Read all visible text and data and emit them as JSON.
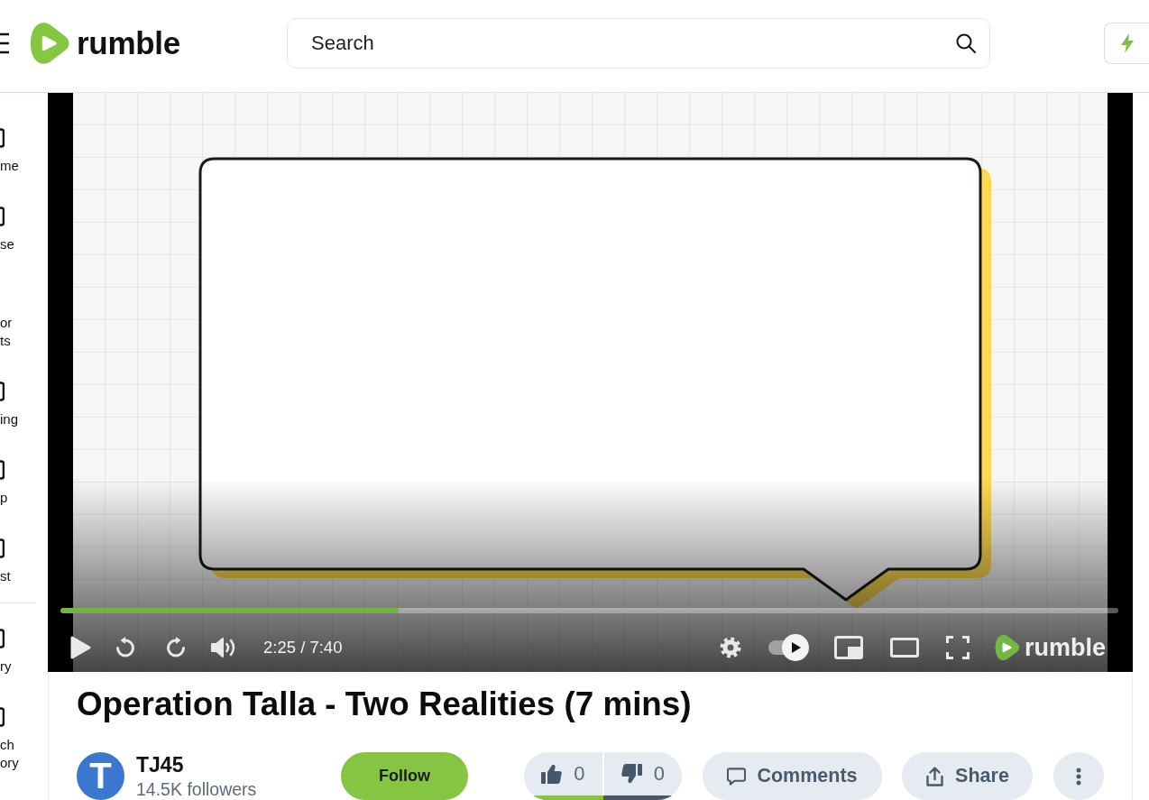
{
  "header": {
    "logo_text": "rumble",
    "search": {
      "placeholder": "Search"
    }
  },
  "sidebar": {
    "sections": [
      {
        "items": [
          {
            "label": "me",
            "has_icon": true
          },
          {
            "label": "se",
            "has_icon": true
          },
          {
            "label": "or ts",
            "has_icon": false
          },
          {
            "label": "ing",
            "has_icon": true
          },
          {
            "label": "p",
            "has_icon": true
          },
          {
            "label": "st",
            "has_icon": true
          }
        ]
      },
      {
        "items": [
          {
            "label": "ry",
            "has_icon": true
          },
          {
            "label": "ch ory",
            "has_icon": true
          }
        ]
      }
    ]
  },
  "player": {
    "progress": {
      "level": 0.32
    },
    "playing": false,
    "time": "2:25 / 7:40",
    "autoplay": {
      "on": true
    },
    "logo_text": "rumble"
  },
  "video": {
    "title": "Operation Talla - Two Realities (7 mins)",
    "channel": {
      "avatar_letter": "T",
      "name": "TJ45",
      "followers": "14.5K followers"
    },
    "follow_button": "Follow",
    "votes": {
      "likes": "0",
      "dislikes": "0",
      "rating": {
        "level": 0.5
      }
    },
    "actions": [
      {
        "kind": "comments",
        "label": "Comments"
      },
      {
        "kind": "share",
        "label": "Share"
      },
      {
        "kind": "more"
      }
    ]
  }
}
